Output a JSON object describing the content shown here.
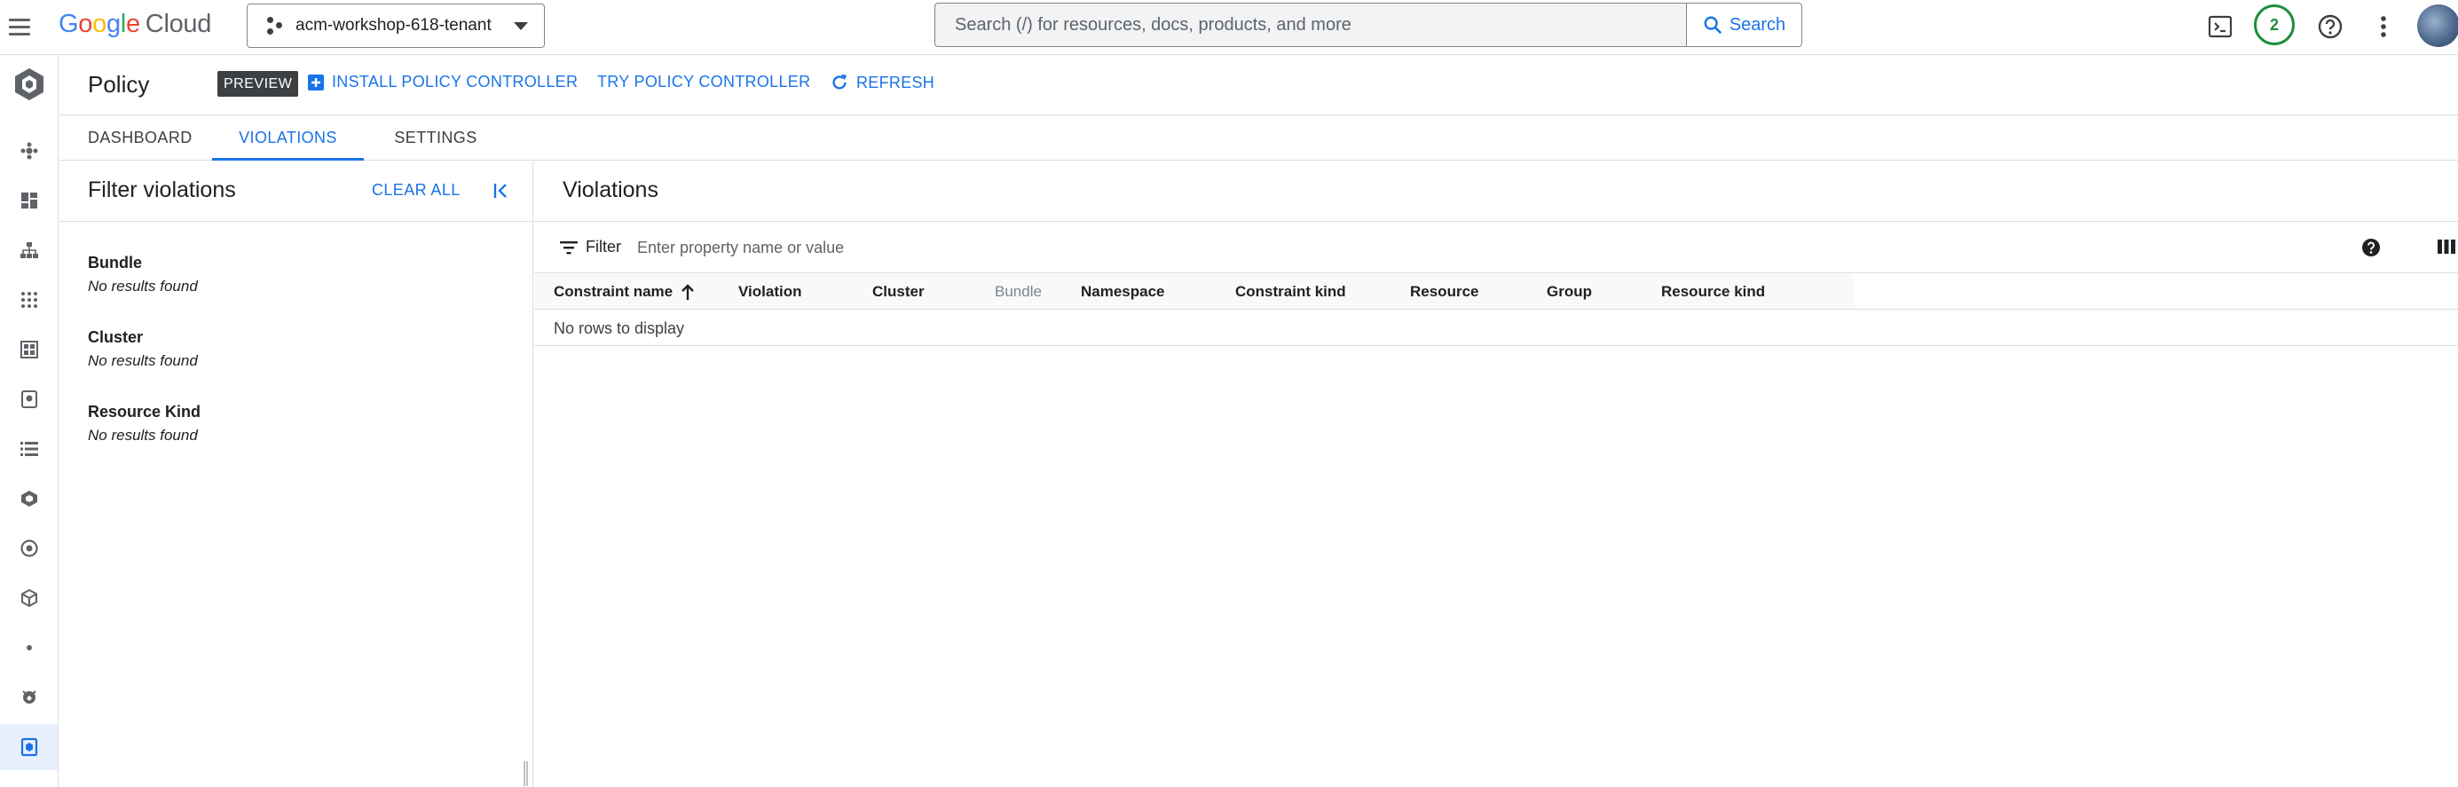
{
  "topbar": {
    "logo_google": "Google",
    "logo_cloud": "Cloud",
    "project_name": "acm-workshop-618-tenant",
    "search_placeholder": "Search (/) for resources, docs, products, and more",
    "search_button": "Search",
    "notification_count": "2"
  },
  "header": {
    "title": "Policy",
    "badge": "PREVIEW",
    "actions": {
      "install": "INSTALL POLICY CONTROLLER",
      "try": "TRY POLICY CONTROLLER",
      "refresh": "REFRESH"
    }
  },
  "tabs": [
    {
      "label": "DASHBOARD",
      "active": false
    },
    {
      "label": "VIOLATIONS",
      "active": true
    },
    {
      "label": "SETTINGS",
      "active": false
    }
  ],
  "filter_panel": {
    "title": "Filter violations",
    "clear_all": "CLEAR ALL",
    "groups": [
      {
        "label": "Bundle",
        "empty": "No results found"
      },
      {
        "label": "Cluster",
        "empty": "No results found"
      },
      {
        "label": "Resource Kind",
        "empty": "No results found"
      }
    ]
  },
  "violations": {
    "title": "Violations",
    "filter_label": "Filter",
    "filter_placeholder": "Enter property name or value",
    "columns": [
      "Constraint name",
      "Violation",
      "Cluster",
      "Bundle",
      "Namespace",
      "Constraint kind",
      "Resource",
      "Group",
      "Resource kind"
    ],
    "sorted_column": "Constraint name",
    "sort_direction": "ascending",
    "empty_message": "No rows to display"
  },
  "colors": {
    "accent": "#1a73e8",
    "text": "#202124",
    "divider": "#dadce0",
    "badge_bg": "#3c4043",
    "notification_ring": "#1e8e3e"
  }
}
